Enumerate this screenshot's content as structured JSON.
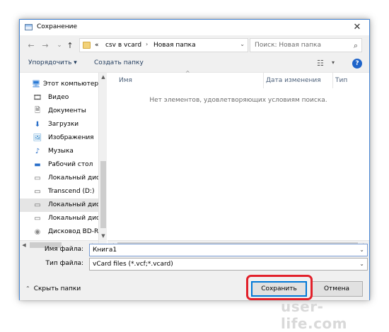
{
  "window": {
    "title": "Сохранение",
    "close_glyph": "✕"
  },
  "nav": {
    "back_glyph": "←",
    "forward_glyph": "→",
    "recent_glyph": "⌄",
    "up_glyph": "↑",
    "breadcrumb": [
      "«",
      "csv в vcard",
      "Новая папка"
    ],
    "crumb_sep": "›",
    "address_drop": "⌄",
    "refresh_glyph": "↻",
    "search_placeholder": "Поиск: Новая папка",
    "search_glyph": "⌕"
  },
  "toolbar": {
    "organize_label": "Упорядочить ▾",
    "new_folder_label": "Создать папку",
    "view_glyph": "☷",
    "view_drop": "▾",
    "help_glyph": "?"
  },
  "sidebar": {
    "items": [
      {
        "label": "Этот компьютер",
        "icon": "computer-icon",
        "glyph": "🖥"
      },
      {
        "label": "Видео",
        "icon": "video-folder-icon",
        "glyph": "🎞"
      },
      {
        "label": "Документы",
        "icon": "documents-folder-icon",
        "glyph": "🗎"
      },
      {
        "label": "Загрузки",
        "icon": "downloads-folder-icon",
        "glyph": "⬇"
      },
      {
        "label": "Изображения",
        "icon": "pictures-folder-icon",
        "glyph": "🖼"
      },
      {
        "label": "Музыка",
        "icon": "music-folder-icon",
        "glyph": "♪"
      },
      {
        "label": "Рабочий стол",
        "icon": "desktop-folder-icon",
        "glyph": "▬"
      },
      {
        "label": "Локальный дис",
        "icon": "drive-icon",
        "glyph": "▭"
      },
      {
        "label": "Transcend (D:)",
        "icon": "usb-drive-icon",
        "glyph": "▭"
      },
      {
        "label": "Локальный дис",
        "icon": "drive-icon",
        "glyph": "▭",
        "selected": true
      },
      {
        "label": "Локальный дис",
        "icon": "drive-icon",
        "glyph": "▭"
      },
      {
        "label": "Дисковод BD-R(",
        "icon": "optical-drive-icon",
        "glyph": "◉"
      }
    ],
    "scroll_up": "▲",
    "scroll_down": "▼",
    "scroll_left": "◀",
    "scroll_right": "▶"
  },
  "files": {
    "columns": [
      "Имя",
      "Дата изменения",
      "Тип"
    ],
    "sort_glyph": "^",
    "empty_message": "Нет элементов, удовлетворяющих условиям поиска."
  },
  "form": {
    "filename_label": "Имя файла:",
    "filename_value": "Книга1",
    "filetype_label": "Тип файла:",
    "filetype_value": "vCard files (*.vcf;*.vcard)",
    "drop_glyph": "⌄"
  },
  "footer": {
    "hide_folders_glyph": "⌃",
    "hide_folders_label": "Скрыть папки",
    "save_label": "Сохранить",
    "cancel_label": "Отмена"
  },
  "watermark": "user-life.com",
  "colors": {
    "accent": "#0078d7",
    "highlight": "#e2202a",
    "help": "#1f64c9"
  }
}
